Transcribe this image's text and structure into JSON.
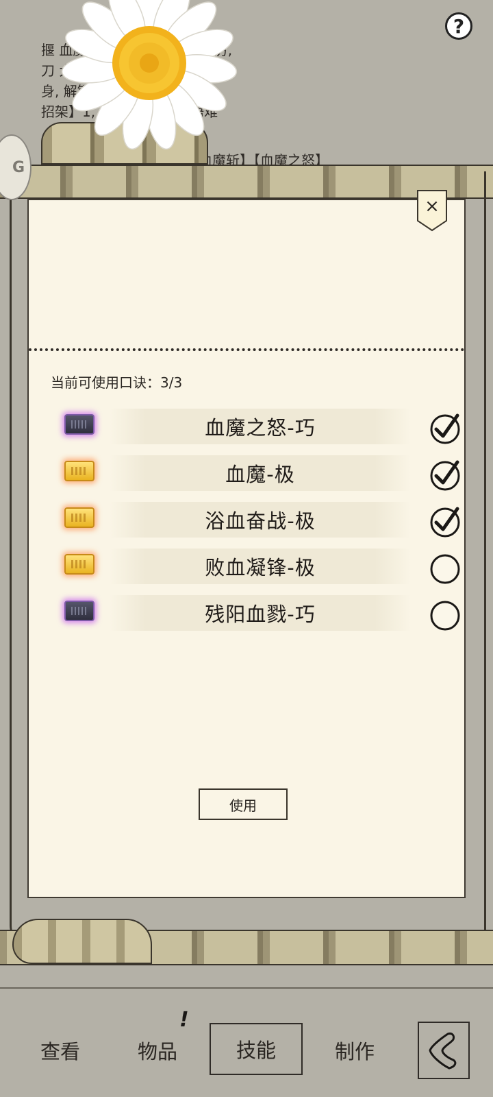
{
  "background": {
    "description_lines": [
      "揠          血魔祖师所创,刀法狠绝凌厉,",
      "刀           大,施展起来,只为伤敌,不顾自",
      "身,            解锁8个招式.",
      "           招架】1,【内伤】1,【领悟难"
    ],
    "moves_line": "血魔斩】【血魔之怒】"
  },
  "help_label": "?",
  "side_tab_label": "G",
  "modal": {
    "close_label": "×",
    "count_label": "当前可使用口诀：",
    "count_value": "3/3",
    "use_label": "使用",
    "skills": [
      {
        "name": "血魔之怒-巧",
        "rarity": "purple",
        "checked": true
      },
      {
        "name": "血魔-极",
        "rarity": "gold",
        "checked": true
      },
      {
        "name": "浴血奋战-极",
        "rarity": "gold",
        "checked": true
      },
      {
        "name": "败血凝锋-极",
        "rarity": "gold",
        "checked": false
      },
      {
        "name": "残阳血戮-巧",
        "rarity": "purple",
        "checked": false
      }
    ]
  },
  "nav": {
    "view": "查看",
    "items": "物品",
    "items_badge": "!",
    "skills": "技能",
    "craft": "制作"
  },
  "colors": {
    "paper": "#faf5e6",
    "background": "#b4b1a7",
    "gold_glow": "#ff7828",
    "purple_glow": "#be46f0"
  }
}
